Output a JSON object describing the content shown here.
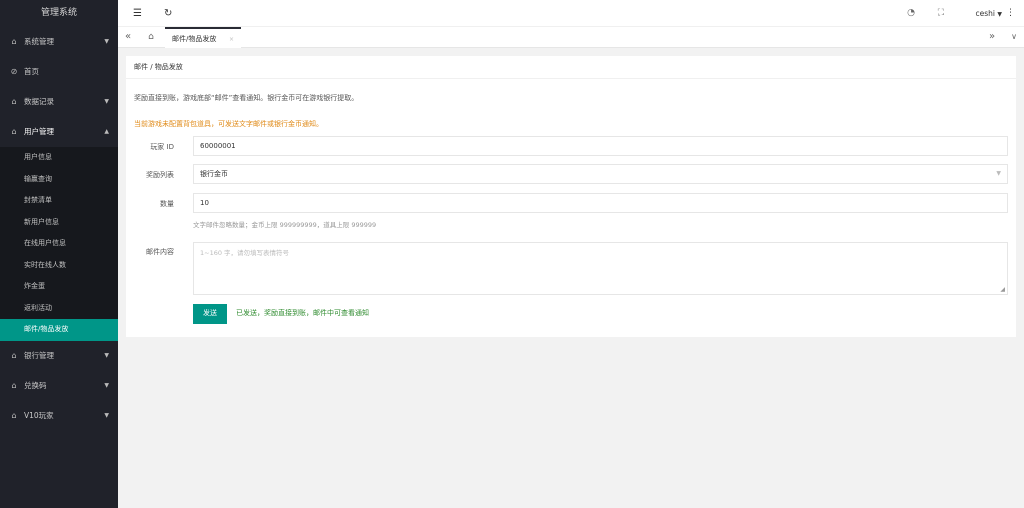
{
  "app": {
    "title": "管理系统"
  },
  "sidebar": {
    "items": [
      {
        "label": "系统管理",
        "icon": "home-icon",
        "caret": "▼"
      },
      {
        "label": "首页",
        "icon": "dashboard-icon"
      },
      {
        "label": "数据记录",
        "icon": "home-icon",
        "caret": "▼"
      },
      {
        "label": "用户管理",
        "icon": "home-icon",
        "caret": "▲"
      },
      {
        "label": "银行管理",
        "icon": "home-icon",
        "caret": "▼"
      },
      {
        "label": "兑换码",
        "icon": "home-icon",
        "caret": "▼"
      },
      {
        "label": "V10玩家",
        "icon": "home-icon",
        "caret": "▼"
      }
    ],
    "user_submenu": [
      "用户信息",
      "输赢查询",
      "封禁清单",
      "新用户信息",
      "在线用户信息",
      "实时在线人数",
      "炸金蛋",
      "返利活动",
      "邮件/物品发放"
    ]
  },
  "topbar": {
    "user": "ceshi"
  },
  "tabs": {
    "active": "邮件/物品发放",
    "close": "×"
  },
  "breadcrumb": {
    "text": "邮件 / 物品发放"
  },
  "form": {
    "description": "奖励直接到账，游戏底部“邮件”查看通知。银行金币可在游戏银行提取。",
    "warning": "当前游戏未配置背包道具，可发送文字邮件或银行金币通知。",
    "player_label": "玩家 ID",
    "player_value": "60000001",
    "reward_label": "奖励列表",
    "reward_value": "银行金币",
    "qty_label": "数量",
    "qty_value": "10",
    "qty_hint": "文字邮件忽略数量；金币上限 999999999，道具上限 999999",
    "mail_label": "邮件内容",
    "mail_placeholder": "1~160 字，请勿填写表情符号",
    "send_label": "发送",
    "sent_message": "已发送，奖励直接到账，邮件中可查看通知"
  },
  "colors": {
    "accent": "#009688",
    "sidebar_bg": "#20222a",
    "warning": "#e08a17",
    "success": "#2e8b2e"
  }
}
